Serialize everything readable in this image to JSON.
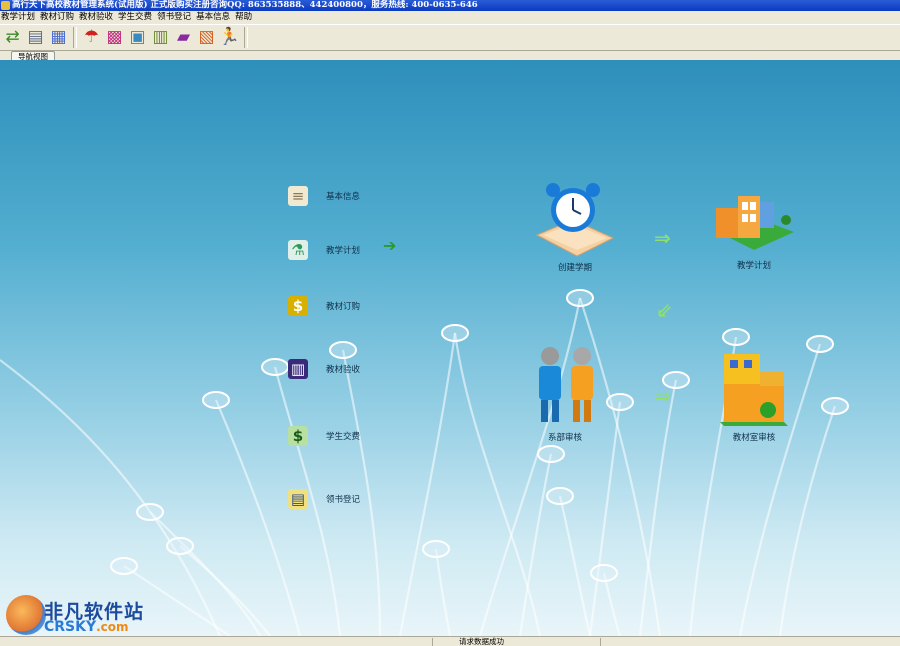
{
  "window": {
    "title": "高行天下高校教材管理系统(试用版) 正式版购买注册咨询QQ: 863535888、442400800，服务热线: 400-0635-646"
  },
  "menu": [
    "教学计划",
    "教材订购",
    "教材验收",
    "学生交费",
    "领书登记",
    "基本信息",
    "帮助"
  ],
  "toolbar": {
    "buttons": [
      {
        "name": "add-button",
        "glyph": "⇄",
        "color": "#3a8a2a"
      },
      {
        "name": "print-button",
        "glyph": "▤",
        "color": "#5a6a8a"
      },
      {
        "name": "preview-button",
        "glyph": "▦",
        "color": "#4a6ad0"
      },
      {
        "name": "umbrella-button",
        "glyph": "☂",
        "color": "#d02020"
      },
      {
        "name": "calendar-button",
        "glyph": "▩",
        "color": "#c03080"
      },
      {
        "name": "image-button",
        "glyph": "▣",
        "color": "#3a8ac0"
      },
      {
        "name": "notebook-button",
        "glyph": "▥",
        "color": "#6a8a30"
      },
      {
        "name": "help-book-button",
        "glyph": "▰",
        "color": "#8a2aa0"
      },
      {
        "name": "gift-button",
        "glyph": "▧",
        "color": "#d06020"
      },
      {
        "name": "exit-button",
        "glyph": "🏃",
        "color": "#d0a000"
      }
    ]
  },
  "tab": "导航视图",
  "nav": [
    {
      "label": "基本信息",
      "icon": "scroll-icon",
      "glyph": "📜",
      "color": "#8a7a5a"
    },
    {
      "label": "教学计划",
      "icon": "lab-icon",
      "glyph": "⚗",
      "color": "#2a9a5a"
    },
    {
      "label": "教材订购",
      "icon": "money-icon",
      "glyph": "$",
      "color": "#c8a000"
    },
    {
      "label": "教材验收",
      "icon": "books-icon",
      "glyph": "▥",
      "color": "#4a2a8a"
    },
    {
      "label": "学生交费",
      "icon": "cash-icon",
      "glyph": "$",
      "color": "#2a7a2a"
    },
    {
      "label": "领书登记",
      "icon": "register-icon",
      "glyph": "▤",
      "color": "#2a4a8a"
    }
  ],
  "flow": {
    "create_term": "创建学期",
    "plan": "教学计划",
    "dept_review": "系部审核",
    "office_review": "教材室审核"
  },
  "status": {
    "message": "请求数据成功"
  },
  "watermark": {
    "cn": "非凡软件站",
    "en": "CRSKY",
    "domain": ".com"
  }
}
